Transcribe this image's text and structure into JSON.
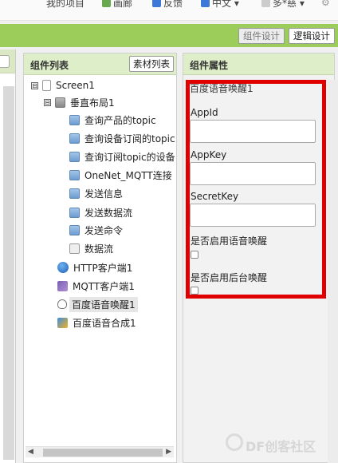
{
  "topbar": {
    "my_projects": "我的项目",
    "gallery": "画廊",
    "feedback": "反馈",
    "language": "中文 ▾",
    "user": "多*慈 ▾"
  },
  "design_tabs": {
    "designer": "组件设计",
    "blocks": "逻辑设计"
  },
  "components_panel": {
    "title": "组件列表",
    "media_button": "素材列表",
    "tree": [
      {
        "label": "Screen1",
        "toggle": "⊟",
        "icon": "screen-icon"
      },
      {
        "label": "垂直布局1",
        "toggle": "⊟",
        "icon": "layout-icon"
      },
      {
        "label": "查询产品的topic",
        "icon": "textbox-icon"
      },
      {
        "label": "查询设备订阅的topic",
        "icon": "textbox-icon"
      },
      {
        "label": "查询订阅topic的设备",
        "icon": "textbox-icon"
      },
      {
        "label": "OneNet_MQTT连接",
        "icon": "textbox-icon"
      },
      {
        "label": "发送信息",
        "icon": "textbox-icon"
      },
      {
        "label": "发送数据流",
        "icon": "textbox-icon"
      },
      {
        "label": "发送命令",
        "icon": "textbox-icon"
      },
      {
        "label": "数据流",
        "icon": "clock-icon"
      },
      {
        "label": "HTTP客户端1",
        "icon": "web-icon"
      },
      {
        "label": "MQTT客户端1",
        "icon": "mqtt-icon"
      },
      {
        "label": "百度语音唤醒1",
        "icon": "voice-wakeup-icon"
      },
      {
        "label": "百度语音合成1",
        "icon": "tts-icon"
      }
    ]
  },
  "properties_panel": {
    "title": "组件属性",
    "component_name": "百度语音唤醒1",
    "fields": [
      {
        "label": "AppId",
        "value": ""
      },
      {
        "label": "AppKey",
        "value": ""
      },
      {
        "label": "SecretKey",
        "value": ""
      }
    ],
    "checkboxes": [
      {
        "label": "是否启用语音唤醒",
        "checked": false
      },
      {
        "label": "是否启用后台唤醒",
        "checked": false
      }
    ]
  },
  "colors": {
    "green_bar": "#9ccd5b",
    "panel_header": "#ddeec8",
    "highlight_box": "#e00000"
  },
  "watermark": "DF创客社区"
}
